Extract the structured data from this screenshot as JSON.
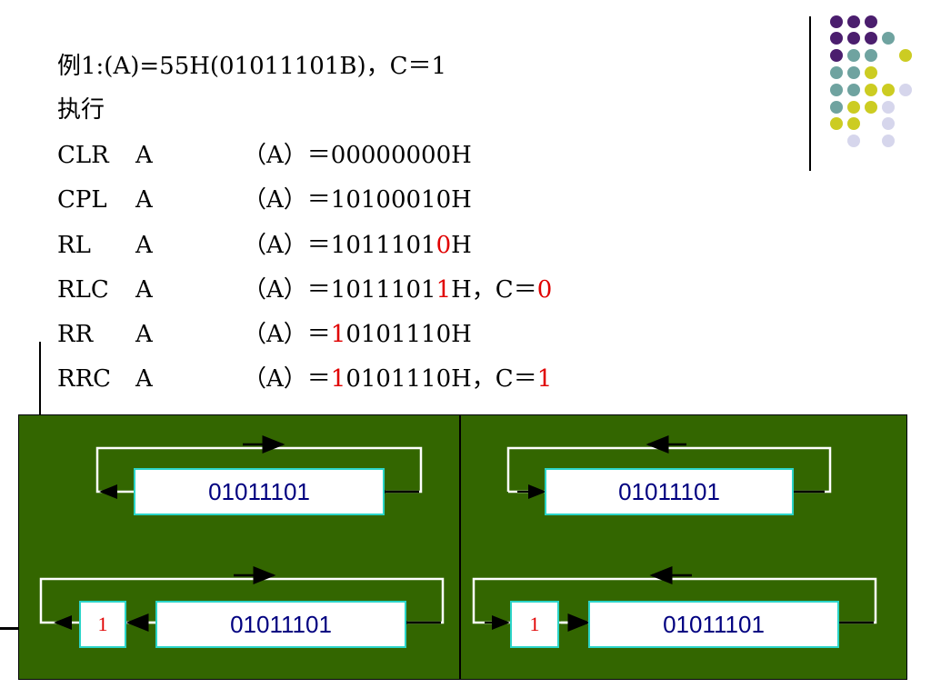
{
  "slide": {
    "title": "例1:(A)=55H(01011101B)，C＝1",
    "exec_label": "执行",
    "rows": [
      {
        "op": "CLR",
        "arg": "A",
        "result": [
          {
            "t": "（A）＝00000000H",
            "red": false
          }
        ]
      },
      {
        "op": "CPL",
        "arg": "A",
        "result": [
          {
            "t": "（A）＝10100010H",
            "red": false
          }
        ]
      },
      {
        "op": "RL",
        "arg": "A",
        "result": [
          {
            "t": "（A）＝1011101",
            "red": false
          },
          {
            "t": "0",
            "red": true
          },
          {
            "t": "H",
            "red": false
          }
        ]
      },
      {
        "op": "RLC",
        "arg": "A",
        "result": [
          {
            "t": "（A）＝1011101",
            "red": false
          },
          {
            "t": "1",
            "red": true
          },
          {
            "t": "H，C＝",
            "red": false
          },
          {
            "t": "0",
            "red": true
          }
        ]
      },
      {
        "op": "RR",
        "arg": "A",
        "result": [
          {
            "t": "（A）＝",
            "red": false
          },
          {
            "t": "1",
            "red": true
          },
          {
            "t": "0101110H",
            "red": false
          }
        ]
      },
      {
        "op": "RRC",
        "arg": "A",
        "result": [
          {
            "t": "（A）＝",
            "red": false
          },
          {
            "t": "1",
            "red": true
          },
          {
            "t": "0101110H，C＝",
            "red": false
          },
          {
            "t": "1",
            "red": true
          }
        ]
      }
    ]
  },
  "diagrams": {
    "rl_register": "01011101",
    "rr_register": "01011101",
    "rlc_register": "01011101",
    "rlc_carry": "1",
    "rrc_register": "01011101",
    "rrc_carry": "1"
  },
  "colors": {
    "panel": "#336600",
    "register_border": "#2bd4c8",
    "register_text": "#000080",
    "highlight": "#e00000",
    "dot_purple": "#4b1e6e",
    "dot_teal": "#6fa3a0",
    "dot_yellow": "#cccc22",
    "dot_lavender": "#d6d6ec"
  }
}
